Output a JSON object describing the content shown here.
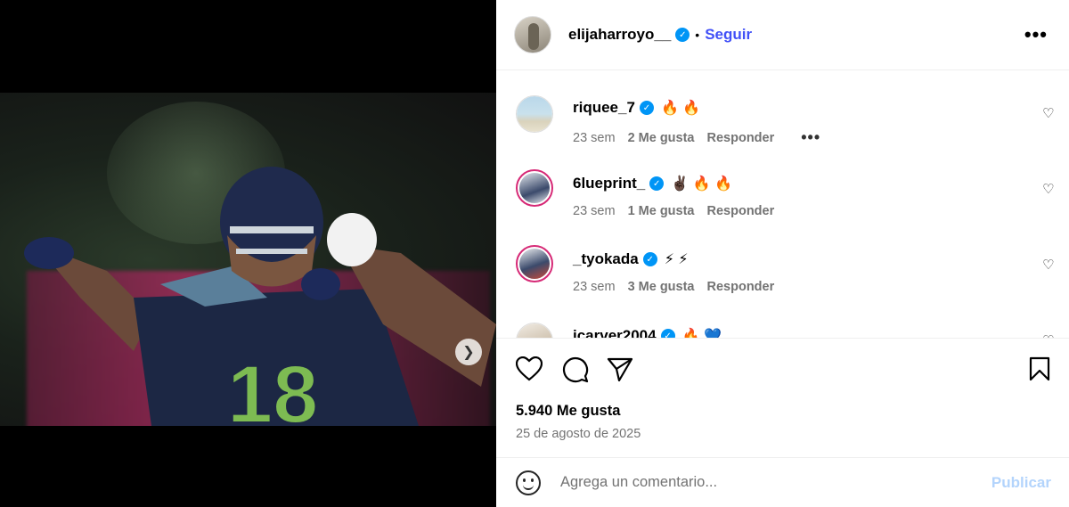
{
  "post": {
    "username": "elijaharroyo__",
    "follow_label": "Seguir",
    "separator": "•",
    "carousel": {
      "slides": 6,
      "active_index": 0
    }
  },
  "comments": [
    {
      "username": "riquee_7",
      "text": "🔥 🔥",
      "time": "23 sem",
      "likes": "2 Me gusta",
      "reply": "Responder",
      "show_more": true
    },
    {
      "username": "6lueprint_",
      "text": "✌🏿 🔥 🔥",
      "time": "23 sem",
      "likes": "1 Me gusta",
      "reply": "Responder",
      "show_more": false
    },
    {
      "username": "_tyokada",
      "text": "⚡ ⚡",
      "time": "23 sem",
      "likes": "3 Me gusta",
      "reply": "Responder",
      "show_more": false
    },
    {
      "username": "jcarver2004",
      "text": "🔥 💙",
      "time": "",
      "likes": "",
      "reply": "",
      "show_more": false
    }
  ],
  "actions": {
    "likes_count": "5.940 Me gusta",
    "date": "25 de agosto de 2025"
  },
  "composer": {
    "placeholder": "Agrega un comentario...",
    "publish_label": "Publicar"
  },
  "colors": {
    "follow": "#4150f7",
    "verified": "#0095f6",
    "publish_disabled": "#b3d4fc",
    "muted": "#737373"
  }
}
